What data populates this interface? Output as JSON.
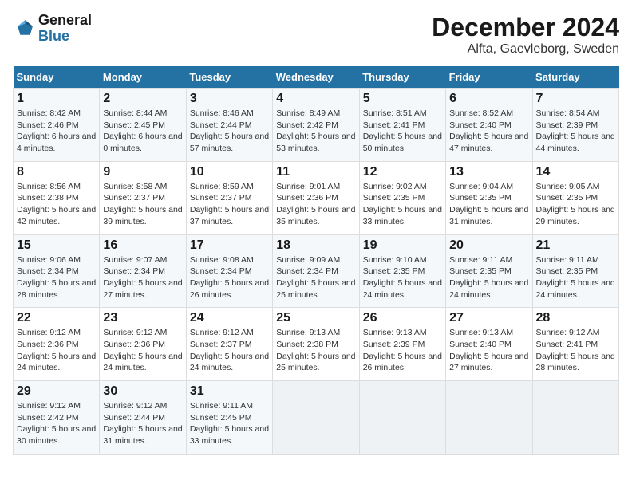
{
  "logo": {
    "line1": "General",
    "line2": "Blue"
  },
  "title": "December 2024",
  "subtitle": "Alfta, Gaevleborg, Sweden",
  "headers": [
    "Sunday",
    "Monday",
    "Tuesday",
    "Wednesday",
    "Thursday",
    "Friday",
    "Saturday"
  ],
  "weeks": [
    [
      {
        "day": "1",
        "sunrise": "Sunrise: 8:42 AM",
        "sunset": "Sunset: 2:46 PM",
        "daylight": "Daylight: 6 hours and 4 minutes."
      },
      {
        "day": "2",
        "sunrise": "Sunrise: 8:44 AM",
        "sunset": "Sunset: 2:45 PM",
        "daylight": "Daylight: 6 hours and 0 minutes."
      },
      {
        "day": "3",
        "sunrise": "Sunrise: 8:46 AM",
        "sunset": "Sunset: 2:44 PM",
        "daylight": "Daylight: 5 hours and 57 minutes."
      },
      {
        "day": "4",
        "sunrise": "Sunrise: 8:49 AM",
        "sunset": "Sunset: 2:42 PM",
        "daylight": "Daylight: 5 hours and 53 minutes."
      },
      {
        "day": "5",
        "sunrise": "Sunrise: 8:51 AM",
        "sunset": "Sunset: 2:41 PM",
        "daylight": "Daylight: 5 hours and 50 minutes."
      },
      {
        "day": "6",
        "sunrise": "Sunrise: 8:52 AM",
        "sunset": "Sunset: 2:40 PM",
        "daylight": "Daylight: 5 hours and 47 minutes."
      },
      {
        "day": "7",
        "sunrise": "Sunrise: 8:54 AM",
        "sunset": "Sunset: 2:39 PM",
        "daylight": "Daylight: 5 hours and 44 minutes."
      }
    ],
    [
      {
        "day": "8",
        "sunrise": "Sunrise: 8:56 AM",
        "sunset": "Sunset: 2:38 PM",
        "daylight": "Daylight: 5 hours and 42 minutes."
      },
      {
        "day": "9",
        "sunrise": "Sunrise: 8:58 AM",
        "sunset": "Sunset: 2:37 PM",
        "daylight": "Daylight: 5 hours and 39 minutes."
      },
      {
        "day": "10",
        "sunrise": "Sunrise: 8:59 AM",
        "sunset": "Sunset: 2:37 PM",
        "daylight": "Daylight: 5 hours and 37 minutes."
      },
      {
        "day": "11",
        "sunrise": "Sunrise: 9:01 AM",
        "sunset": "Sunset: 2:36 PM",
        "daylight": "Daylight: 5 hours and 35 minutes."
      },
      {
        "day": "12",
        "sunrise": "Sunrise: 9:02 AM",
        "sunset": "Sunset: 2:35 PM",
        "daylight": "Daylight: 5 hours and 33 minutes."
      },
      {
        "day": "13",
        "sunrise": "Sunrise: 9:04 AM",
        "sunset": "Sunset: 2:35 PM",
        "daylight": "Daylight: 5 hours and 31 minutes."
      },
      {
        "day": "14",
        "sunrise": "Sunrise: 9:05 AM",
        "sunset": "Sunset: 2:35 PM",
        "daylight": "Daylight: 5 hours and 29 minutes."
      }
    ],
    [
      {
        "day": "15",
        "sunrise": "Sunrise: 9:06 AM",
        "sunset": "Sunset: 2:34 PM",
        "daylight": "Daylight: 5 hours and 28 minutes."
      },
      {
        "day": "16",
        "sunrise": "Sunrise: 9:07 AM",
        "sunset": "Sunset: 2:34 PM",
        "daylight": "Daylight: 5 hours and 27 minutes."
      },
      {
        "day": "17",
        "sunrise": "Sunrise: 9:08 AM",
        "sunset": "Sunset: 2:34 PM",
        "daylight": "Daylight: 5 hours and 26 minutes."
      },
      {
        "day": "18",
        "sunrise": "Sunrise: 9:09 AM",
        "sunset": "Sunset: 2:34 PM",
        "daylight": "Daylight: 5 hours and 25 minutes."
      },
      {
        "day": "19",
        "sunrise": "Sunrise: 9:10 AM",
        "sunset": "Sunset: 2:35 PM",
        "daylight": "Daylight: 5 hours and 24 minutes."
      },
      {
        "day": "20",
        "sunrise": "Sunrise: 9:11 AM",
        "sunset": "Sunset: 2:35 PM",
        "daylight": "Daylight: 5 hours and 24 minutes."
      },
      {
        "day": "21",
        "sunrise": "Sunrise: 9:11 AM",
        "sunset": "Sunset: 2:35 PM",
        "daylight": "Daylight: 5 hours and 24 minutes."
      }
    ],
    [
      {
        "day": "22",
        "sunrise": "Sunrise: 9:12 AM",
        "sunset": "Sunset: 2:36 PM",
        "daylight": "Daylight: 5 hours and 24 minutes."
      },
      {
        "day": "23",
        "sunrise": "Sunrise: 9:12 AM",
        "sunset": "Sunset: 2:36 PM",
        "daylight": "Daylight: 5 hours and 24 minutes."
      },
      {
        "day": "24",
        "sunrise": "Sunrise: 9:12 AM",
        "sunset": "Sunset: 2:37 PM",
        "daylight": "Daylight: 5 hours and 24 minutes."
      },
      {
        "day": "25",
        "sunrise": "Sunrise: 9:13 AM",
        "sunset": "Sunset: 2:38 PM",
        "daylight": "Daylight: 5 hours and 25 minutes."
      },
      {
        "day": "26",
        "sunrise": "Sunrise: 9:13 AM",
        "sunset": "Sunset: 2:39 PM",
        "daylight": "Daylight: 5 hours and 26 minutes."
      },
      {
        "day": "27",
        "sunrise": "Sunrise: 9:13 AM",
        "sunset": "Sunset: 2:40 PM",
        "daylight": "Daylight: 5 hours and 27 minutes."
      },
      {
        "day": "28",
        "sunrise": "Sunrise: 9:12 AM",
        "sunset": "Sunset: 2:41 PM",
        "daylight": "Daylight: 5 hours and 28 minutes."
      }
    ],
    [
      {
        "day": "29",
        "sunrise": "Sunrise: 9:12 AM",
        "sunset": "Sunset: 2:42 PM",
        "daylight": "Daylight: 5 hours and 30 minutes."
      },
      {
        "day": "30",
        "sunrise": "Sunrise: 9:12 AM",
        "sunset": "Sunset: 2:44 PM",
        "daylight": "Daylight: 5 hours and 31 minutes."
      },
      {
        "day": "31",
        "sunrise": "Sunrise: 9:11 AM",
        "sunset": "Sunset: 2:45 PM",
        "daylight": "Daylight: 5 hours and 33 minutes."
      },
      null,
      null,
      null,
      null
    ]
  ]
}
